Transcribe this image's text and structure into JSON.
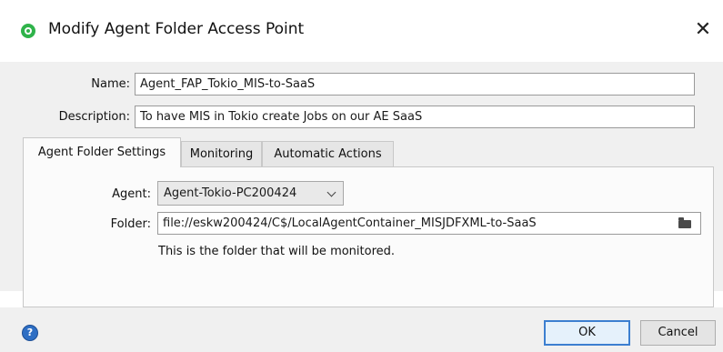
{
  "dialog": {
    "title": "Modify Agent Folder Access Point",
    "icons": {
      "app": "circle-dot-icon",
      "close": "close-icon",
      "help": "help-icon",
      "folder": "folder-icon"
    },
    "close_glyph": "✕"
  },
  "form": {
    "name_label": "Name:",
    "name_value": "Agent_FAP_Tokio_MIS-to-SaaS",
    "description_label": "Description:",
    "description_value": "To have MIS in Tokio create Jobs on our AE SaaS"
  },
  "tabs": [
    {
      "label": "Agent Folder Settings",
      "active": true
    },
    {
      "label": "Monitoring",
      "active": false
    },
    {
      "label": "Automatic Actions",
      "active": false
    }
  ],
  "settings": {
    "agent_label": "Agent:",
    "agent_value": "Agent-Tokio-PC200424",
    "folder_label": "Folder:",
    "folder_value": "file://eskw200424/C$/LocalAgentContainer_MISJDFXML-to-SaaS",
    "folder_hint": "This is the folder that will be monitored."
  },
  "footer": {
    "help_glyph": "?",
    "ok_label": "OK",
    "cancel_label": "Cancel"
  },
  "colors": {
    "accent": "#2fb34a",
    "default_button_border": "#3c7fd0",
    "help": "#2f6fc4"
  }
}
